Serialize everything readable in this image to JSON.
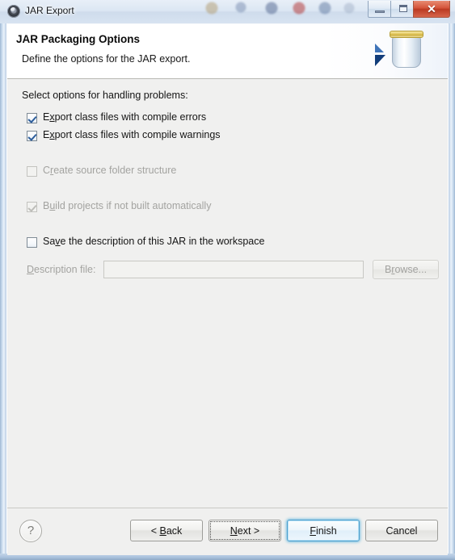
{
  "window": {
    "title": "JAR Export",
    "icon": "eclipse-icon",
    "controls": {
      "minimize": "minimize-icon",
      "maximize": "restore-icon",
      "close": "✕"
    }
  },
  "header": {
    "title": "JAR Packaging Options",
    "subtitle": "Define the options for the JAR export.",
    "art": "jar-illustration"
  },
  "body": {
    "intro": "Select options for handling problems:",
    "options": [
      {
        "label_pre": "E",
        "label_mnemonic": "x",
        "label_post": "port class files with compile errors",
        "checked": true,
        "enabled": true,
        "name": "export-class-files-compile-errors"
      },
      {
        "label_pre": "E",
        "label_mnemonic": "x",
        "label_post": "port class files with compile warnings",
        "checked": true,
        "enabled": true,
        "name": "export-class-files-compile-warnings"
      },
      {
        "label_pre": "C",
        "label_mnemonic": "r",
        "label_post": "eate source folder structure",
        "checked": false,
        "enabled": false,
        "name": "create-source-folder-structure"
      },
      {
        "label_pre": "B",
        "label_mnemonic": "u",
        "label_post": "ild projects if not built automatically",
        "checked": true,
        "enabled": false,
        "name": "build-projects-if-not-built-automatically"
      },
      {
        "label_pre": "Sa",
        "label_mnemonic": "v",
        "label_post": "e the description of this JAR in the workspace",
        "checked": false,
        "enabled": true,
        "name": "save-description-of-jar-in-workspace"
      }
    ],
    "description_file": {
      "label_pre": "",
      "label_mnemonic": "D",
      "label_post": "escription file:",
      "value": "",
      "placeholder": "",
      "enabled": false
    },
    "browse": {
      "label_pre": "B",
      "label_mnemonic": "r",
      "label_post": "owse...",
      "enabled": false
    }
  },
  "footer": {
    "help": "?",
    "buttons": [
      {
        "label_pre": "< ",
        "label_mnemonic": "B",
        "label_post": "ack",
        "state": "normal",
        "name": "back-button"
      },
      {
        "label_pre": "",
        "label_mnemonic": "N",
        "label_post": "ext >",
        "state": "focused",
        "name": "next-button"
      },
      {
        "label_pre": "",
        "label_mnemonic": "F",
        "label_post": "inish",
        "state": "default",
        "name": "finish-button"
      },
      {
        "label_pre": "Cancel",
        "label_mnemonic": "",
        "label_post": "",
        "state": "normal",
        "name": "cancel-button"
      }
    ]
  },
  "colors": {
    "accent": "#4f9fce",
    "close_button": "#bb3a22",
    "body_background": "#f0f0ef",
    "disabled_text": "#a3a3a0"
  }
}
